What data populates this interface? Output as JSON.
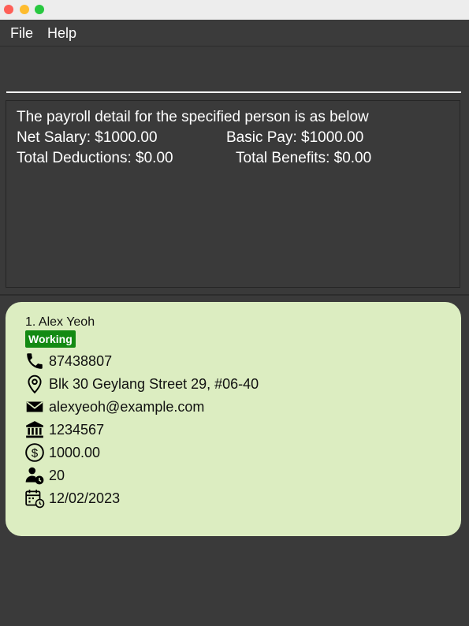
{
  "menu": {
    "file": "File",
    "help": "Help"
  },
  "command": {
    "value": ""
  },
  "result": {
    "intro": "The payroll detail for the specified person is as below",
    "net_salary": "Net Salary: $1000.00",
    "basic_pay": "Basic Pay: $1000.00",
    "total_deductions": "Total Deductions: $0.00",
    "total_benefits": "Total Benefits: $0.00"
  },
  "person": {
    "name": "1.  Alex Yeoh",
    "status": "Working",
    "phone": "87438807",
    "address": "Blk 30 Geylang Street 29, #06-40",
    "email": "alexyeoh@example.com",
    "bank_account": "1234567",
    "salary": "1000.00",
    "leave": "20",
    "join_date": "12/02/2023"
  },
  "colors": {
    "card_bg": "#dcedc1",
    "status_badge": "#138a13",
    "window_bg": "#3a3a3a"
  },
  "icons": [
    "phone-icon",
    "location-icon",
    "email-icon",
    "bank-icon",
    "dollar-icon",
    "person-clock-icon",
    "calendar-clock-icon"
  ]
}
